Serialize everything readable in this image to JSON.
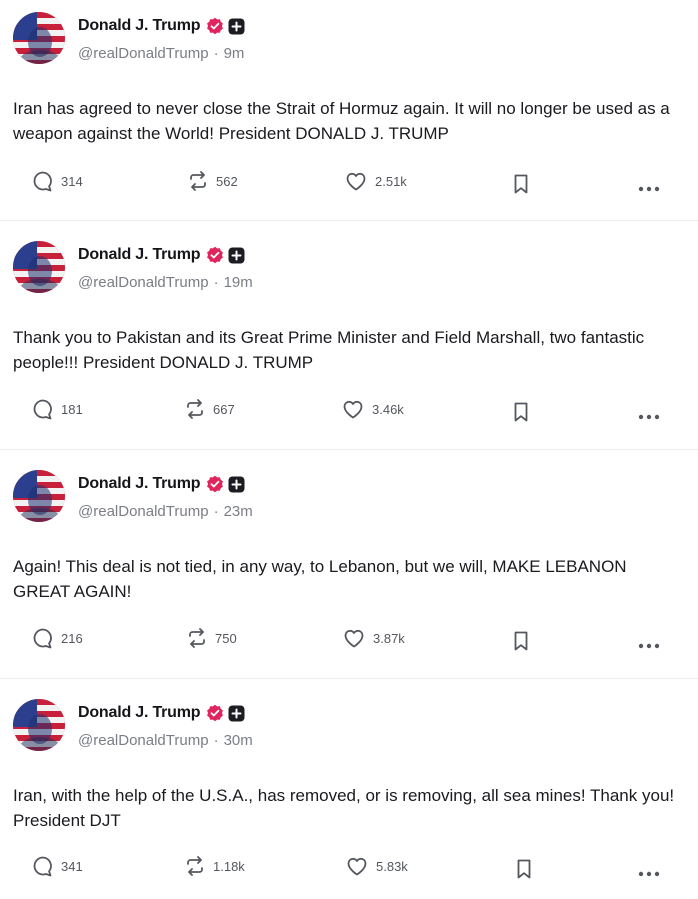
{
  "posts": [
    {
      "author": "Donald J. Trump",
      "handle": "@realDonaldTrump",
      "separator": "·",
      "time": "9m",
      "text": "Iran has agreed to never close the Strait of Hormuz again. It will no longer be used as a weapon against the World! President DONALD J. TRUMP",
      "replies": "314",
      "reposts": "562",
      "likes": "2.51k"
    },
    {
      "author": "Donald J. Trump",
      "handle": "@realDonaldTrump",
      "separator": "·",
      "time": "19m",
      "text": "Thank you to Pakistan and its Great Prime Minister and Field Marshall, two fantastic people!!! President DONALD J. TRUMP",
      "replies": "181",
      "reposts": "667",
      "likes": "3.46k"
    },
    {
      "author": "Donald J. Trump",
      "handle": "@realDonaldTrump",
      "separator": "·",
      "time": "23m",
      "text": "Again! This deal is not tied, in any way, to Lebanon, but we will, MAKE LEBANON GREAT AGAIN!",
      "replies": "216",
      "reposts": "750",
      "likes": "3.87k"
    },
    {
      "author": "Donald J. Trump",
      "handle": "@realDonaldTrump",
      "separator": "·",
      "time": "30m",
      "text": "Iran, with the help of the U.S.A., has removed, or is removing, all sea mines! Thank you! President DJT",
      "replies": "341",
      "reposts": "1.18k",
      "likes": "5.83k"
    }
  ],
  "icons": {
    "reply": "speech-bubble-icon",
    "repost": "repost-arrows-icon",
    "like": "heart-icon",
    "bookmark": "bookmark-icon",
    "more": "ellipsis-icon",
    "verified": "verified-badge-icon",
    "plus": "plus-badge-icon"
  },
  "colors": {
    "verified": "#e0245e",
    "text": "#1a1a1f",
    "muted": "#7b7d87",
    "icon": "#55575f"
  }
}
